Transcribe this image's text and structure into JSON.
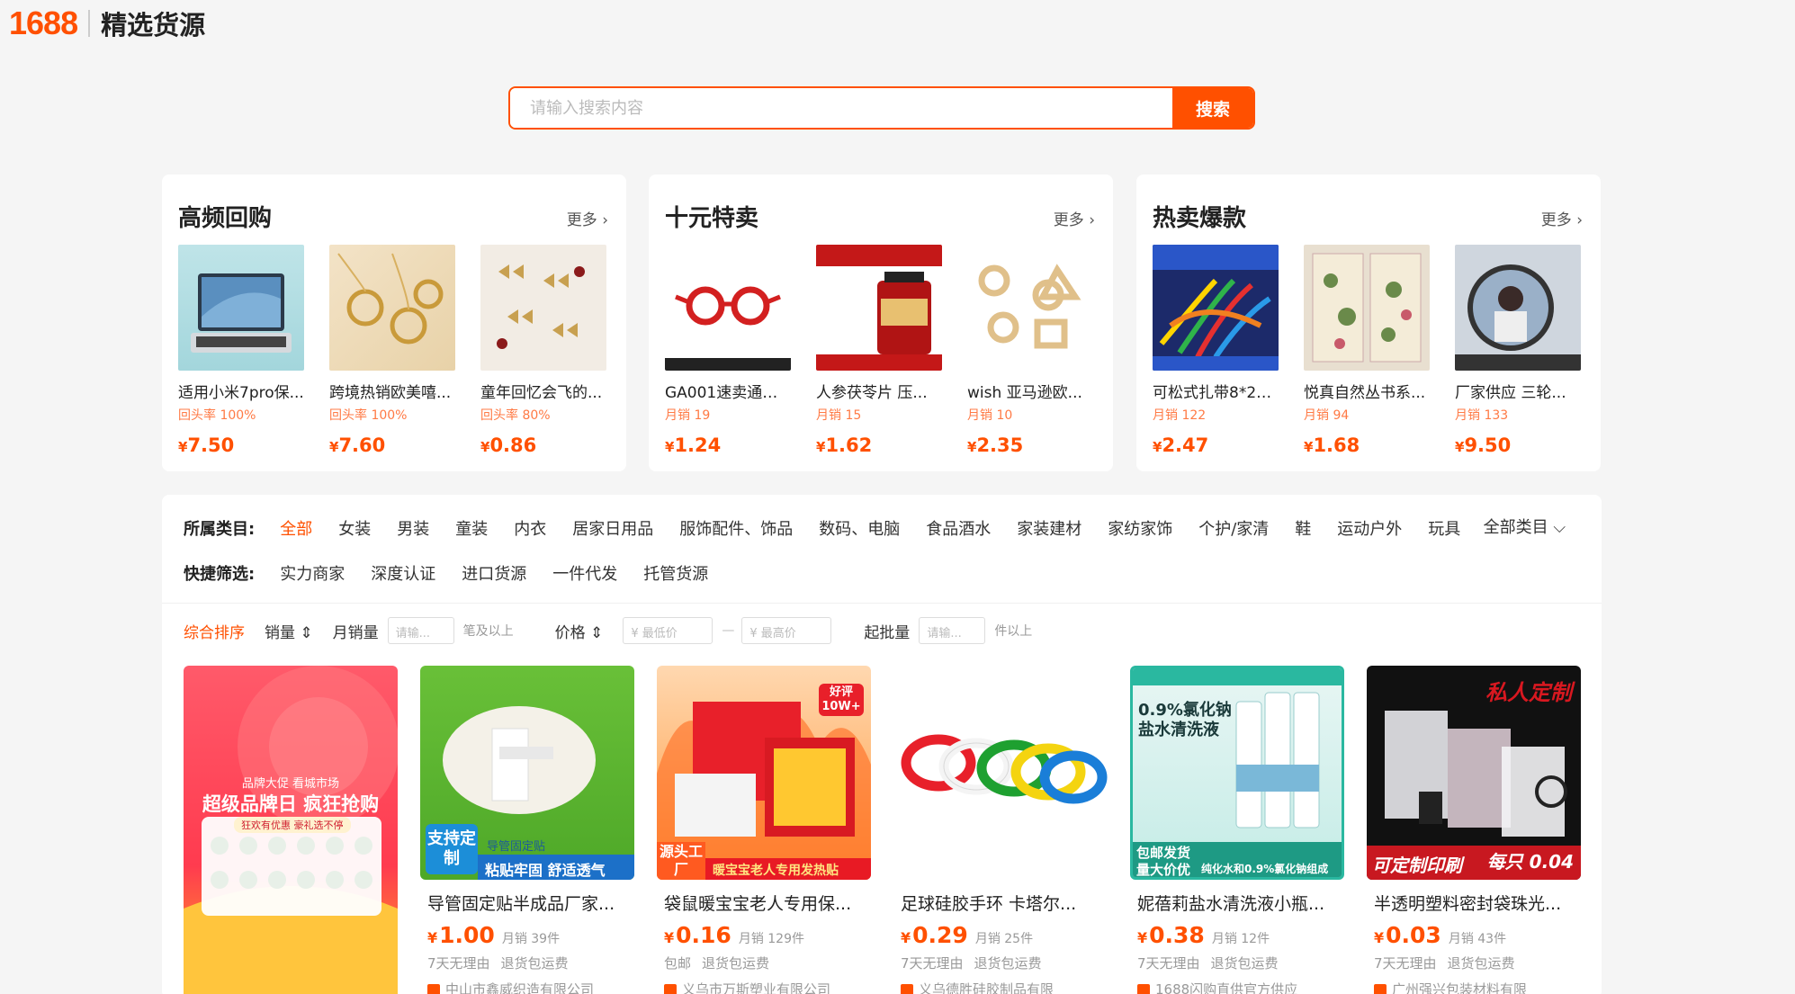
{
  "header": {
    "logo_num": "1688",
    "logo_text": "精选货源"
  },
  "search": {
    "placeholder": "请输入搜索内容",
    "button": "搜索"
  },
  "panels": [
    {
      "title": "高频回购",
      "more": "更多 ›",
      "items": [
        {
          "name": "适用小米7pro保...",
          "sub": "回头率 100%",
          "currency": "¥",
          "price": "7.50"
        },
        {
          "name": "跨境热销欧美嘻...",
          "sub": "回头率 100%",
          "currency": "¥",
          "price": "7.60"
        },
        {
          "name": "童年回忆会飞的...",
          "sub": "回头率 80%",
          "currency": "¥",
          "price": "0.86"
        }
      ]
    },
    {
      "title": "十元特卖",
      "more": "更多 ›",
      "items": [
        {
          "name": "GA001速卖通平...",
          "sub": "月销 19",
          "currency": "¥",
          "price": "1.24"
        },
        {
          "name": "人参茯苓片 压...",
          "sub": "月销 15",
          "currency": "¥",
          "price": "1.62"
        },
        {
          "name": "wish 亚马逊欧...",
          "sub": "月销 10",
          "currency": "¥",
          "price": "2.35"
        }
      ]
    },
    {
      "title": "热卖爆款",
      "more": "更多 ›",
      "items": [
        {
          "name": "可松式扎带8*25...",
          "sub": "月销 122",
          "currency": "¥",
          "price": "2.47"
        },
        {
          "name": "悦真自然丛书系...",
          "sub": "月销 94",
          "currency": "¥",
          "price": "1.68"
        },
        {
          "name": "厂家供应 三轮...",
          "sub": "月销 133",
          "currency": "¥",
          "price": "9.50"
        }
      ]
    }
  ],
  "filters": {
    "category_label": "所属类目:",
    "categories": [
      "全部",
      "女装",
      "男装",
      "童装",
      "内衣",
      "居家日用品",
      "服饰配件、饰品",
      "数码、电脑",
      "食品酒水",
      "家装建材",
      "家纺家饰",
      "个护/家清",
      "鞋",
      "运动户外",
      "玩具"
    ],
    "all_categories": "全部类目 ⌵",
    "quick_label": "快捷筛选:",
    "quick": [
      "实力商家",
      "深度认证",
      "进口货源",
      "一件代发",
      "托管货源"
    ]
  },
  "sort": {
    "composite": "综合排序",
    "sales": "销量 ⇕",
    "monthly": "月销量",
    "input_placeholder": "请输...",
    "monthly_hint": "笔及以上",
    "price": "价格 ⇕",
    "min_price": "¥ 最低价",
    "dash": "—",
    "max_price": "¥ 最高价",
    "moq": "起批量",
    "moq_hint": "件以上"
  },
  "products": [
    {
      "name": "",
      "currency": "",
      "price": "",
      "sales": "",
      "tags": [],
      "shop": "",
      "banner_title": "超级品牌日 疯狂抢购",
      "banner_sub": "狂欢有优惠 豪礼选不停",
      "banner_top": "品牌大促 看城市场"
    },
    {
      "name": "导管固定贴半成品厂家...",
      "currency": "¥",
      "price": "1.00",
      "sales": "月销 39件",
      "tags": [
        "7天无理由",
        "退货包运费"
      ],
      "shop": "中山市鑫威织造有限公司",
      "overlay": "粘贴牢固 舒适透气",
      "badge": "支持定制",
      "top_label": "导管固定贴"
    },
    {
      "name": "袋鼠暖宝宝老人专用保...",
      "currency": "¥",
      "price": "0.16",
      "sales": "月销 129件",
      "tags": [
        "包邮",
        "退货包运费"
      ],
      "shop": "义乌市万斯塑业有限公司",
      "overlay": "暖宝宝老人专用发热贴",
      "badge": "源头工厂",
      "top_label": "好评10W+"
    },
    {
      "name": "足球硅胶手环 卡塔尔...",
      "currency": "¥",
      "price": "0.29",
      "sales": "月销 25件",
      "tags": [
        "7天无理由",
        "退货包运费"
      ],
      "shop": "义乌德胜硅胶制品有限"
    },
    {
      "name": "妮蓓莉盐水清洗液小瓶...",
      "currency": "¥",
      "price": "0.38",
      "sales": "月销 12件",
      "tags": [
        "7天无理由",
        "退货包运费"
      ],
      "shop": "1688闪购直供官方供应",
      "overlay": "纯化水和0.9%氯化钠组成",
      "badge": "包邮发货 量大价优",
      "top_label": "0.9%氯化钠盐水清洗液"
    },
    {
      "name": "半透明塑料密封袋珠光...",
      "currency": "¥",
      "price": "0.03",
      "sales": "月销 43件",
      "tags": [
        "7天无理由",
        "退货包运费"
      ],
      "shop": "广州强兴包装材料有限",
      "overlay": "可定制印刷",
      "badge": "每只 0.04",
      "top_label": "私人定制"
    }
  ]
}
